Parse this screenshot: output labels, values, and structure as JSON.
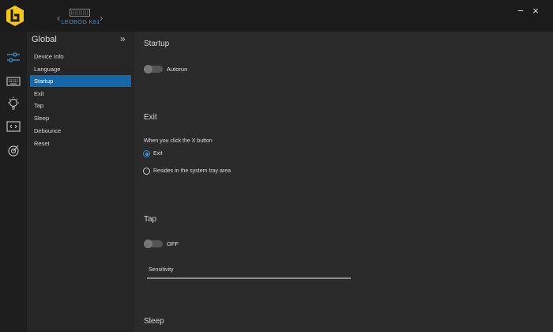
{
  "header": {
    "device_name": "LEOBOG K81",
    "minimize_label": "−",
    "close_label": "×"
  },
  "rail": {
    "items": [
      {
        "icon": "sliders-icon",
        "active": true
      },
      {
        "icon": "keyboard-icon",
        "active": false
      },
      {
        "icon": "lightbulb-icon",
        "active": false
      },
      {
        "icon": "macro-code-icon",
        "active": false
      },
      {
        "icon": "target-icon",
        "active": false
      }
    ]
  },
  "submenu": {
    "title": "Global",
    "collapse_label": "»",
    "items": [
      {
        "label": "Device Info"
      },
      {
        "label": "Language"
      },
      {
        "label": "Startup",
        "active": true
      },
      {
        "label": "Exit"
      },
      {
        "label": "Tap"
      },
      {
        "label": "Sleep"
      },
      {
        "label": "Debounce"
      },
      {
        "label": "Reset"
      }
    ]
  },
  "main": {
    "startup": {
      "title": "Startup",
      "toggle_label": "Autorun",
      "enabled": false
    },
    "exit": {
      "title": "Exit",
      "prompt": "When you click the X button",
      "options": [
        {
          "label": "Exit",
          "checked": true
        },
        {
          "label": "Resides in the system tray area",
          "checked": false
        }
      ]
    },
    "tap": {
      "title": "Tap",
      "toggle_label": "OFF",
      "enabled": false,
      "sensitivity_label": "Sensitivity"
    },
    "sleep": {
      "title": "Sleep"
    }
  },
  "colors": {
    "accent": "#1468a9",
    "logo": "#f5c518",
    "device_name": "#3d8fd8"
  }
}
